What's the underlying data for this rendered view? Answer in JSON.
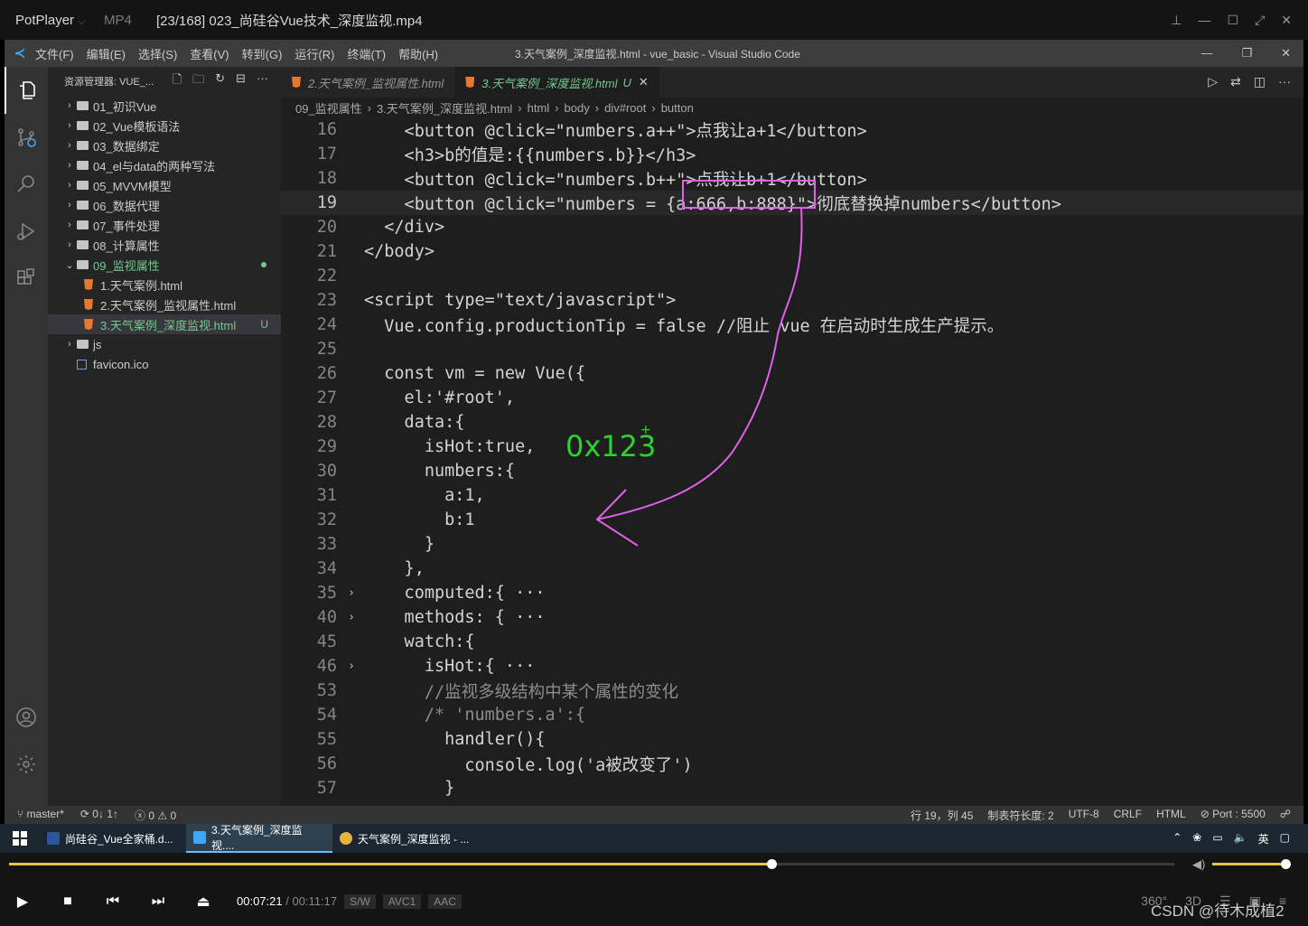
{
  "potplayer": {
    "app_name": "PotPlayer",
    "format": "MP4",
    "file_title": "[23/168] 023_尚硅谷Vue技术_深度监视.mp4"
  },
  "vscode": {
    "menu": [
      "文件(F)",
      "编辑(E)",
      "选择(S)",
      "查看(V)",
      "转到(G)",
      "运行(R)",
      "终端(T)",
      "帮助(H)"
    ],
    "window_title": "3.天气案例_深度监视.html - vue_basic - Visual Studio Code",
    "explorer": {
      "header": "资源管理器: VUE_...",
      "items": [
        {
          "label": "01_初识Vue",
          "type": "folder"
        },
        {
          "label": "02_Vue模板语法",
          "type": "folder"
        },
        {
          "label": "03_数据绑定",
          "type": "folder"
        },
        {
          "label": "04_el与data的两种写法",
          "type": "folder"
        },
        {
          "label": "05_MVVM模型",
          "type": "folder"
        },
        {
          "label": "06_数据代理",
          "type": "folder"
        },
        {
          "label": "07_事件处理",
          "type": "folder"
        },
        {
          "label": "08_计算属性",
          "type": "folder"
        },
        {
          "label": "09_监视属性",
          "type": "folder-open"
        },
        {
          "label": "1.天气案例.html",
          "type": "html"
        },
        {
          "label": "2.天气案例_监视属性.html",
          "type": "html"
        },
        {
          "label": "3.天气案例_深度监视.html",
          "type": "html",
          "status": "U"
        },
        {
          "label": "js",
          "type": "folder"
        },
        {
          "label": "favicon.ico",
          "type": "image"
        }
      ]
    },
    "tabs": [
      {
        "label": "2.天气案例_监视属性.html",
        "active": false
      },
      {
        "label": "3.天气案例_深度监视.html",
        "status": "U",
        "active": true
      }
    ],
    "breadcrumb": [
      "09_监视属性",
      "3.天气案例_深度监视.html",
      "html",
      "body",
      "div#root",
      "button"
    ],
    "code_lines": [
      {
        "n": "16",
        "text": "    <button @click=\"numbers.a++\">点我让a+1</button>"
      },
      {
        "n": "17",
        "text": "    <h3>b的值是:{{numbers.b}}</h3>"
      },
      {
        "n": "18",
        "text": "    <button @click=\"numbers.b++\">点我让b+1</button>"
      },
      {
        "n": "19",
        "text": "    <button @click=\"numbers = {a:666,b:888}\">彻底替换掉numbers</button>",
        "current": true
      },
      {
        "n": "20",
        "text": "  </div>"
      },
      {
        "n": "21",
        "text": "</body>"
      },
      {
        "n": "22",
        "text": ""
      },
      {
        "n": "23",
        "text": "<script type=\"text/javascript\">"
      },
      {
        "n": "24",
        "text": "  Vue.config.productionTip = false //阻止 vue 在启动时生成生产提示。"
      },
      {
        "n": "25",
        "text": ""
      },
      {
        "n": "26",
        "text": "  const vm = new Vue({"
      },
      {
        "n": "27",
        "text": "    el:'#root',"
      },
      {
        "n": "28",
        "text": "    data:{"
      },
      {
        "n": "29",
        "text": "      isHot:true,"
      },
      {
        "n": "30",
        "text": "      numbers:{"
      },
      {
        "n": "31",
        "text": "        a:1,"
      },
      {
        "n": "32",
        "text": "        b:1"
      },
      {
        "n": "33",
        "text": "      }"
      },
      {
        "n": "34",
        "text": "    },"
      },
      {
        "n": "35",
        "text": "    computed:{ ···",
        "folded": true
      },
      {
        "n": "40",
        "text": "    methods: { ···",
        "folded": true
      },
      {
        "n": "45",
        "text": "    watch:{"
      },
      {
        "n": "46",
        "text": "      isHot:{ ···",
        "folded": true
      },
      {
        "n": "53",
        "text": "      //监视多级结构中某个属性的变化"
      },
      {
        "n": "54",
        "text": "      /* 'numbers.a':{"
      },
      {
        "n": "55",
        "text": "        handler(){"
      },
      {
        "n": "56",
        "text": "          console.log('a被改变了')"
      },
      {
        "n": "57",
        "text": "        }"
      }
    ],
    "annotation": "0x123",
    "status": {
      "branch": "master*",
      "sync": "0↓ 1↑",
      "problems": "0",
      "warnings": "0",
      "position": "行 19，列 45",
      "tab_size": "制表符长度: 2",
      "encoding": "UTF-8",
      "eol": "CRLF",
      "language": "HTML",
      "port": "Port : 5500"
    },
    "ime": "英"
  },
  "taskbar": {
    "items": [
      {
        "label": "尚硅谷_Vue全家桶.d...",
        "icon": "word-icon"
      },
      {
        "label": "3.天气案例_深度监视....",
        "icon": "vscode-icon",
        "active": true
      },
      {
        "label": "天气案例_深度监视 - ...",
        "icon": "chrome-icon"
      }
    ],
    "ime": "英"
  },
  "player": {
    "progress": 0.654,
    "volume": 0.95,
    "current_time": "00:07:21",
    "total_time": "00:11:17",
    "chips": [
      "S/W",
      "AVC1",
      "AAC"
    ],
    "right_labels": [
      "360°",
      "3D"
    ]
  },
  "watermark": "CSDN @待木成植2",
  "colors": {
    "accent_yellow": "#e8c547",
    "vscode_blue": "#3ea7f5",
    "git_green": "#73c991",
    "annotation_pink": "#e060e8",
    "annotation_green": "#2fd12f"
  }
}
